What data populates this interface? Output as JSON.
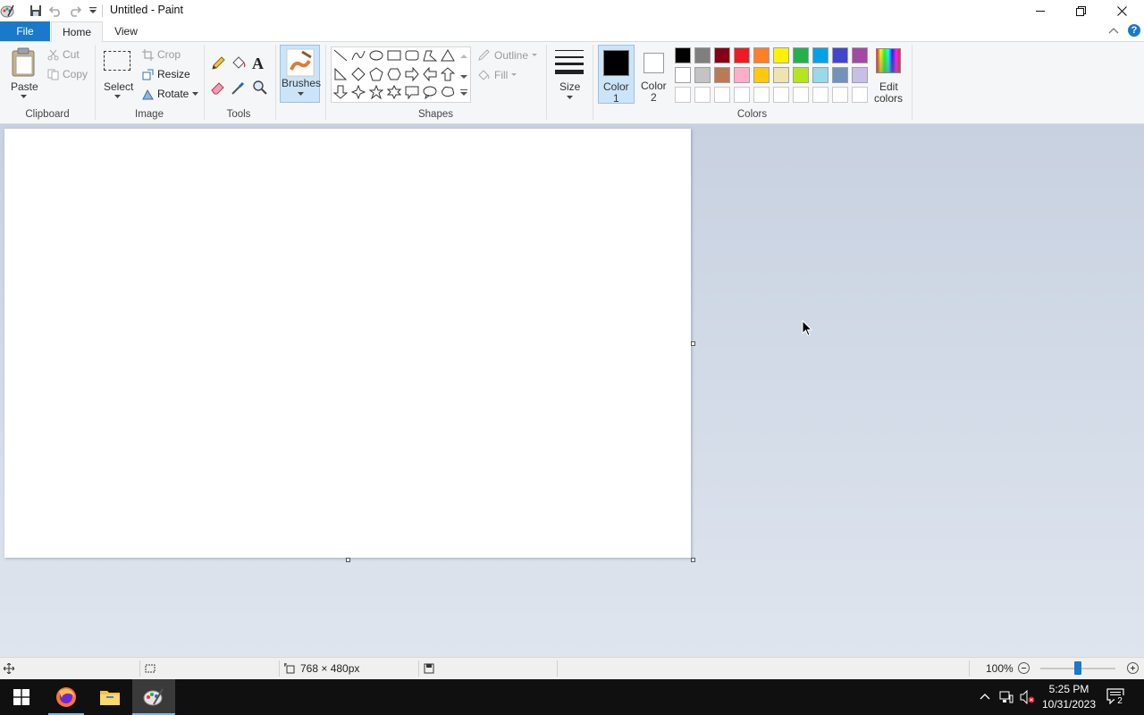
{
  "window": {
    "title": "Untitled - Paint"
  },
  "tabs": {
    "file": "File",
    "home": "Home",
    "view": "View"
  },
  "clipboard": {
    "paste": "Paste",
    "cut": "Cut",
    "copy": "Copy",
    "group": "Clipboard"
  },
  "image": {
    "select": "Select",
    "crop": "Crop",
    "resize": "Resize",
    "rotate": "Rotate",
    "group": "Image"
  },
  "tools": {
    "group": "Tools"
  },
  "brushes": {
    "label": "Brushes"
  },
  "shapes": {
    "outline": "Outline",
    "fill": "Fill",
    "group": "Shapes"
  },
  "size": {
    "label": "Size"
  },
  "colors": {
    "color1_line1": "Color",
    "color1_line2": "1",
    "color2_line1": "Color",
    "color2_line2": "2",
    "edit_line1": "Edit",
    "edit_line2": "colors",
    "group": "Colors",
    "color1_value": "#000000",
    "color2_value": "#ffffff",
    "palette_row1": [
      "#000000",
      "#7f7f7f",
      "#880015",
      "#ed1c24",
      "#ff7f27",
      "#fff200",
      "#22b14c",
      "#00a2e8",
      "#3f48cc",
      "#a349a4"
    ],
    "palette_row2": [
      "#ffffff",
      "#c3c3c3",
      "#b97a57",
      "#ffaec9",
      "#ffc90e",
      "#efe4b0",
      "#b5e61d",
      "#99d9ea",
      "#7092be",
      "#c8bfe7"
    ]
  },
  "status": {
    "canvas_size": "768 × 480px",
    "zoom": "100%",
    "zoom_level": 1.0
  },
  "taskbar": {
    "time": "5:25 PM",
    "date": "10/31/2023",
    "notifications": "2"
  }
}
